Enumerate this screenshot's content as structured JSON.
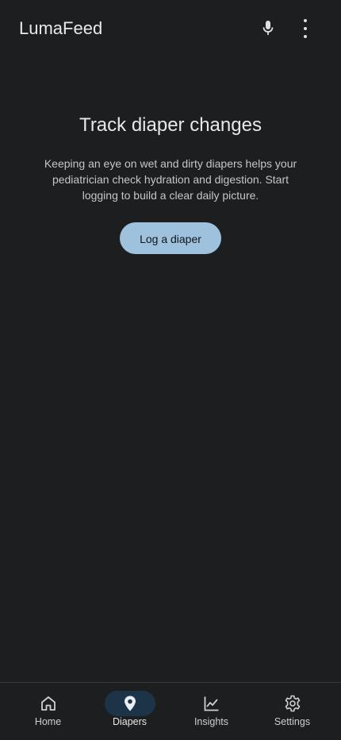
{
  "app_bar": {
    "title": "LumaFeed",
    "actions": [
      {
        "name": "microphone",
        "icon": "mic-icon"
      },
      {
        "name": "more-options",
        "icon": "more-vertical-icon"
      }
    ]
  },
  "empty_state": {
    "title": "Track diaper changes",
    "body": "Keeping an eye on wet and dirty diapers helps your pediatrician check hydration and digestion. Start logging to build a clear daily picture.",
    "button_label": "Log a diaper"
  },
  "bottom_nav": {
    "items": [
      {
        "label": "Home",
        "icon": "home-icon",
        "active": false
      },
      {
        "label": "Diapers",
        "icon": "location-pin-icon",
        "active": true
      },
      {
        "label": "Insights",
        "icon": "trending-chart-icon",
        "active": false
      },
      {
        "label": "Settings",
        "icon": "gear-icon",
        "active": false
      }
    ]
  },
  "colors": {
    "background": "#1d1e20",
    "accent_button": "#9ec2de",
    "active_indicator": "#1d3347"
  }
}
